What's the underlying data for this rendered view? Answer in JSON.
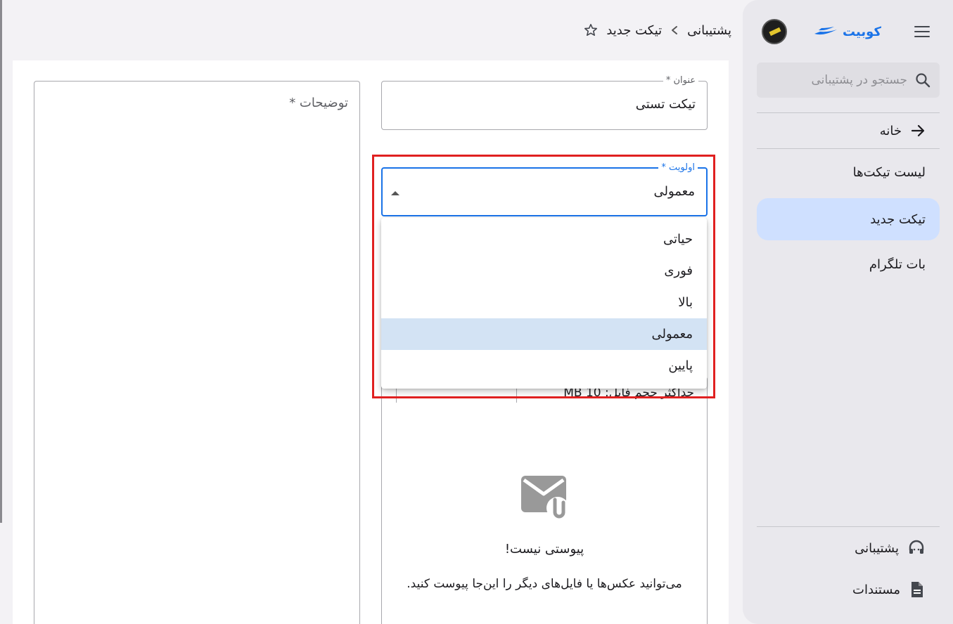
{
  "sidebar": {
    "brand": "کوبیت",
    "search_placeholder": "جستجو در پشتیبانی",
    "home_label": "خانه",
    "items": [
      {
        "label": "لیست تیکت‌ها"
      },
      {
        "label": "تیکت جدید"
      },
      {
        "label": "بات تلگرام"
      }
    ],
    "bottom_items": [
      {
        "label": "پشتیبانی",
        "icon": "headset-icon"
      },
      {
        "label": "مستندات",
        "icon": "document-icon"
      }
    ]
  },
  "breadcrumb": {
    "parent": "پشتیبانی",
    "current": "تیکت جدید"
  },
  "form": {
    "title_label": "عنوان *",
    "title_value": "تیکت تستی",
    "description_label": "توضیحات *",
    "priority_label": "اولویت *",
    "priority_value": "معمولی",
    "priority_options": [
      "حیاتی",
      "فوری",
      "بالا",
      "معمولی",
      "پایین"
    ],
    "attachment": {
      "size_note": "حداکثر حجم فایل: 10 MB",
      "empty_title": "پیوستی نیست!",
      "empty_subtitle": "می‌توانید عکس‌ها یا فایل‌های دیگر را این‌جا پیوست کنید."
    }
  },
  "colors": {
    "accent": "#1a73e8",
    "active_nav": "#cfe0ff",
    "selected_option": "#d3e3f4",
    "highlight": "#e02020"
  }
}
